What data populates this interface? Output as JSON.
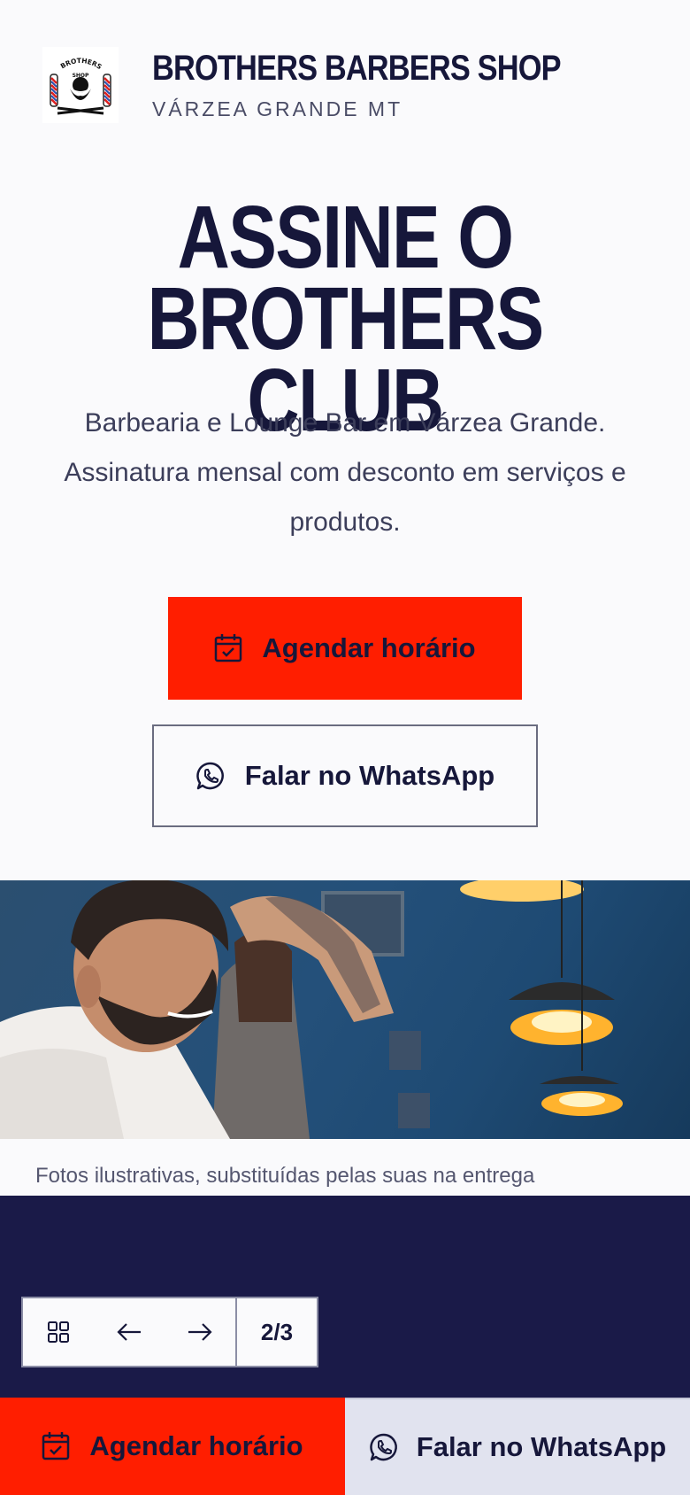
{
  "header": {
    "brand_name": "BROTHERS BARBERS SHOP",
    "location": "VÁRZEA GRANDE MT",
    "logo_text_top": "BROTHERS BARBER",
    "logo_text_bottom": "SHOP"
  },
  "hero": {
    "title_line1": "ASSINE O",
    "title_line2": "BROTHERS CLUB",
    "subtitle": "Barbearia e Lounge Bar em Várzea Grande. Assinatura mensal com desconto em serviços e produtos.",
    "primary_cta": "Agendar horário",
    "secondary_cta": "Falar no WhatsApp"
  },
  "gallery": {
    "caption": "Fotos ilustrativas, substituídas pelas suas na entrega"
  },
  "pager": {
    "current": "2/3"
  },
  "bottom_bar": {
    "primary_cta": "Agendar horário",
    "secondary_cta": "Falar no WhatsApp"
  },
  "colors": {
    "accent_red": "#ff1e00",
    "navy": "#1a1a48",
    "text_dark": "#16173a"
  }
}
